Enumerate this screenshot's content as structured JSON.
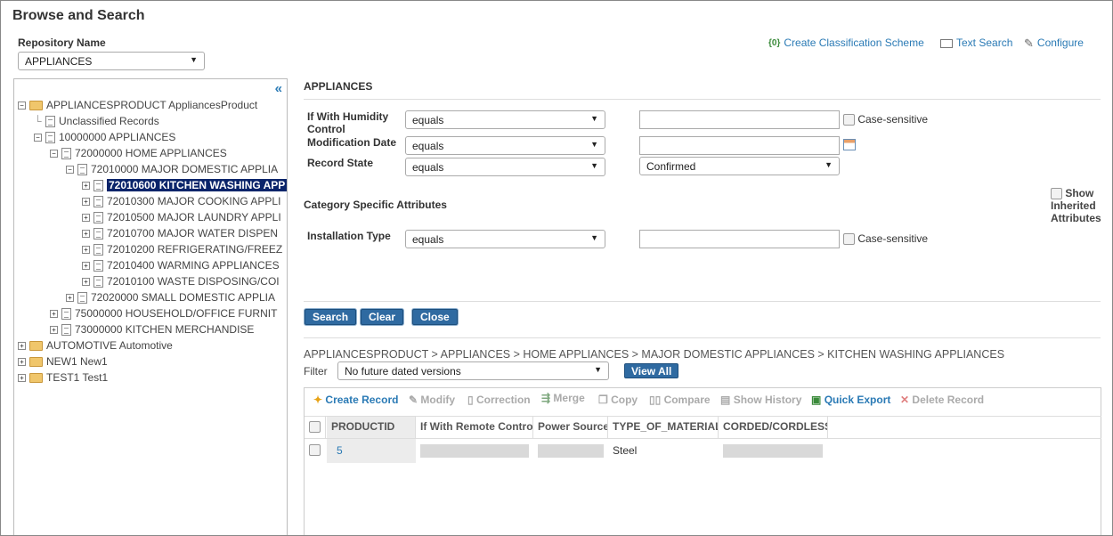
{
  "title": "Browse and Search",
  "repository": {
    "label": "Repository Name",
    "value": "APPLIANCES"
  },
  "top_links": {
    "create_classification": "Create Classification Scheme",
    "text_search": "Text Search",
    "configure": "Configure"
  },
  "tree": {
    "nodes": [
      "APPLIANCESPRODUCT AppliancesProduct",
      "Unclassified Records",
      "10000000 APPLIANCES",
      "72000000 HOME APPLIANCES",
      "72010000 MAJOR DOMESTIC APPLIA",
      "72010600 KITCHEN WASHING APP",
      "72010300 MAJOR COOKING APPLI",
      "72010500 MAJOR LAUNDRY APPLI",
      "72010700 MAJOR WATER DISPEN",
      "72010200 REFRIGERATING/FREEZ",
      "72010400 WARMING APPLIANCES",
      "72010100 WASTE DISPOSING/COI",
      "72020000 SMALL DOMESTIC APPLIA",
      "75000000 HOUSEHOLD/OFFICE FURNIT",
      "73000000 KITCHEN MERCHANDISE",
      "AUTOMOTIVE Automotive",
      "NEW1 New1",
      "TEST1 Test1"
    ]
  },
  "search": {
    "heading": "APPLIANCES",
    "humidity_label": "If With Humidity Control",
    "humidity_op": "equals",
    "case_sensitive": "Case-sensitive",
    "mod_date_label": "Modification Date",
    "mod_date_op": "equals",
    "record_state_label": "Record State",
    "record_state_op": "equals",
    "record_state_value": "Confirmed",
    "category_heading": "Category Specific Attributes",
    "show_inherited": "Show Inherited Attributes",
    "install_label": "Installation Type",
    "install_op": "equals",
    "search_btn": "Search",
    "clear_btn": "Clear",
    "close_btn": "Close"
  },
  "breadcrumb": "APPLIANCESPRODUCT > APPLIANCES > HOME APPLIANCES > MAJOR DOMESTIC APPLIANCES > KITCHEN WASHING APPLIANCES",
  "filter": {
    "label": "Filter",
    "value": "No future dated versions",
    "view_all": "View All"
  },
  "toolbar": {
    "create": "Create Record",
    "modify": "Modify",
    "correction": "Correction",
    "merge": "Merge",
    "copy": "Copy",
    "compare": "Compare",
    "history": "Show History",
    "export": "Quick Export",
    "delete": "Delete Record"
  },
  "grid": {
    "columns": [
      "PRODUCTID",
      "If With Remote Control",
      "Power Source",
      "TYPE_OF_MATERIAL",
      "CORDED/CORDLESS"
    ],
    "row": {
      "productid": "5",
      "material": "Steel"
    }
  }
}
